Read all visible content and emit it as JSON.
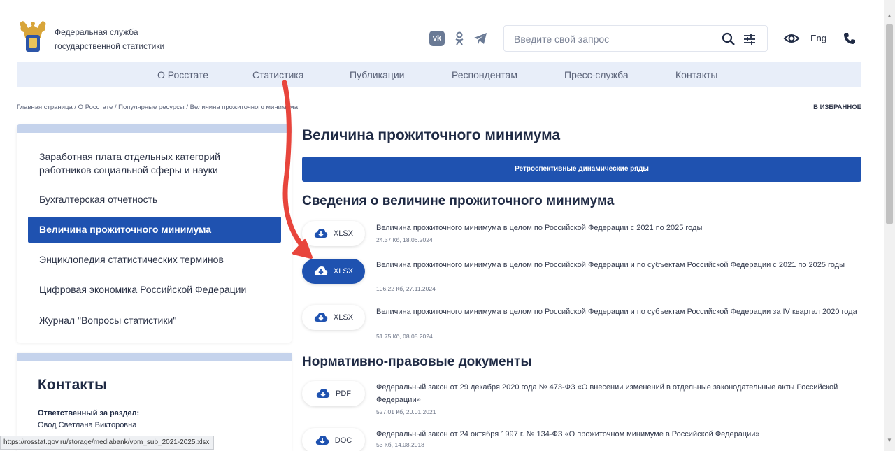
{
  "header": {
    "org_name_line1": "Федеральная служба",
    "org_name_line2": "государственной статистики",
    "search_placeholder": "Введите свой запрос",
    "lang": "Eng",
    "vk": "vk"
  },
  "nav": [
    "О Росстате",
    "Статистика",
    "Публикации",
    "Респондентам",
    "Пресс-служба",
    "Контакты"
  ],
  "breadcrumb": "Главная страница / О Росстате / Популярные ресурсы / Величина прожиточного минимума",
  "favorite": "В ИЗБРАННОЕ",
  "sidebar": {
    "items": [
      "Заработная плата отдельных категорий работников социальной сферы и науки",
      "Бухгалтерская отчетность",
      "Величина прожиточного минимума",
      "Энциклопедия статистических терминов",
      "Цифровая экономика Российской Федерации",
      "Журнал \"Вопросы статистики\""
    ]
  },
  "contacts": {
    "title": "Контакты",
    "responsible_label": "Ответственный за раздел:",
    "responsible_name": "Овод Светлана Викторовна"
  },
  "main": {
    "title": "Величина прожиточного минимума",
    "retro_button": "Ретроспективные динамические ряды",
    "section1_title": "Сведения о величине прожиточного минимума",
    "section2_title": "Нормативно-правовые документы",
    "files": [
      {
        "type": "XLSX",
        "title": "Величина прожиточного минимума в целом по Российской Федерации с 2021 по 2025 годы",
        "meta": "24.37 Кб, 18.06.2024"
      },
      {
        "type": "XLSX",
        "title": "Величина прожиточного минимума в целом по Российской Федерации и по субъектам Российской Федерации с 2021 по 2025 годы",
        "meta": "106.22 Кб, 27.11.2024"
      },
      {
        "type": "XLSX",
        "title": "Величина прожиточного минимума в целом по Российской Федерации и по субъектам Российской Федерации за IV квартал 2020 года",
        "meta": "51.75 Кб, 08.05.2024"
      }
    ],
    "docs": [
      {
        "type": "PDF",
        "title": "Федеральный закон от 29 декабря 2020 года № 473-ФЗ «О внесении изменений в отдельные законодательные акты Российской Федерации»",
        "meta": "527.01 Кб, 20.01.2021"
      },
      {
        "type": "DOC",
        "title": "Федеральный закон от 24 октября 1997 г. № 134-ФЗ «О прожиточном минимуме в Российской Федерации»",
        "meta": "53 Кб, 14.08.2018"
      }
    ]
  },
  "status_url": "https://rosstat.gov.ru/storage/mediabank/vpm_sub_2021-2025.xlsx",
  "colors": {
    "accent": "#1f52b0",
    "nav_bg": "#e8eef9",
    "annotation_arrow": "#e8453c"
  }
}
